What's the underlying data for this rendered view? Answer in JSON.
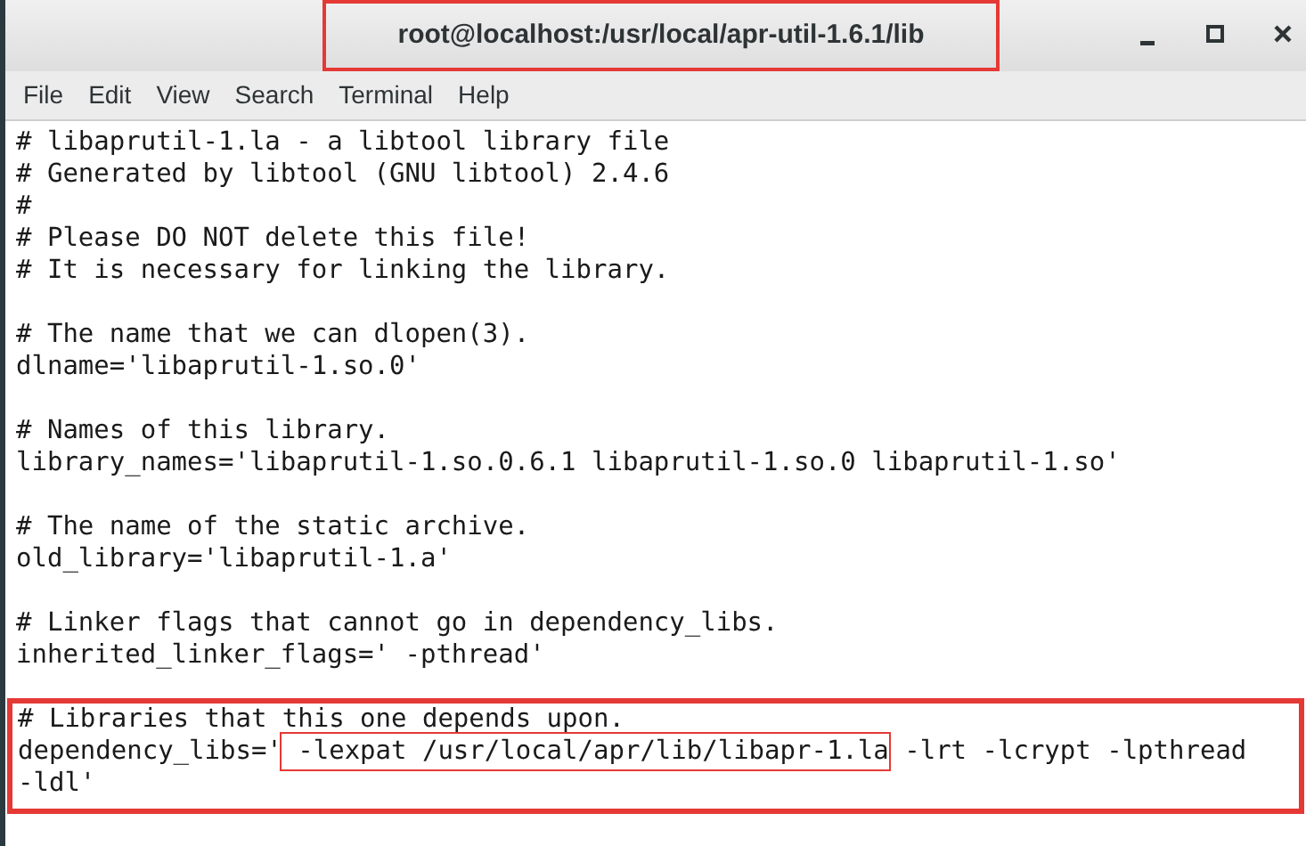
{
  "window": {
    "title": "root@localhost:/usr/local/apr-util-1.6.1/lib",
    "title_highlighted": true
  },
  "menu": [
    "File",
    "Edit",
    "View",
    "Search",
    "Terminal",
    "Help"
  ],
  "blocks": [
    {
      "highlighted": false,
      "lines": [
        "# libaprutil-1.la - a libtool library file",
        "# Generated by libtool (GNU libtool) 2.4.6",
        "#",
        "# Please DO NOT delete this file!",
        "# It is necessary for linking the library."
      ]
    },
    {
      "highlighted": false,
      "lines": [
        "# The name that we can dlopen(3).",
        "dlname='libaprutil-1.so.0'"
      ]
    },
    {
      "highlighted": false,
      "lines": [
        "# Names of this library.",
        "library_names='libaprutil-1.so.0.6.1 libaprutil-1.so.0 libaprutil-1.so'"
      ]
    },
    {
      "highlighted": false,
      "lines": [
        "# The name of the static archive.",
        "old_library='libaprutil-1.a'"
      ]
    },
    {
      "highlighted": false,
      "lines": [
        "# Linker flags that cannot go in dependency_libs.",
        "inherited_linker_flags=' -pthread'"
      ]
    },
    {
      "highlighted": true,
      "lines": [
        "# Libraries that this one depends upon.",
        {
          "segments": [
            {
              "text": "dependency_libs='",
              "highlighted": false
            },
            {
              "text": " -lexpat /usr/local/apr/lib/libapr-1.la",
              "highlighted": true
            },
            {
              "text": " -lrt -lcrypt -lpthread",
              "highlighted": false
            }
          ]
        },
        "-ldl'"
      ]
    }
  ]
}
